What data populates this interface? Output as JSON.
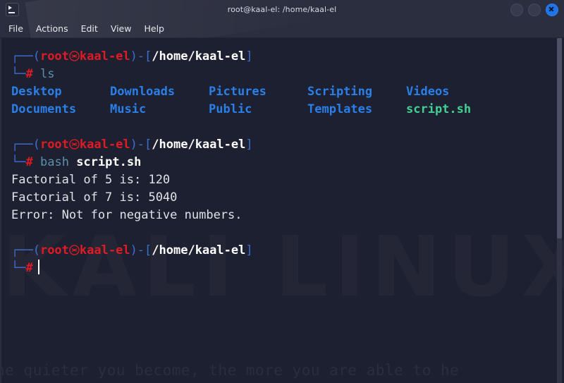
{
  "window": {
    "title": "root@kaal-el: /home/kaal-el",
    "icon": "terminal-icon",
    "buttons": {
      "minimize": "minimize",
      "maximize": "maximize",
      "close": "close"
    }
  },
  "menubar": {
    "items": [
      {
        "label": "File"
      },
      {
        "label": "Actions"
      },
      {
        "label": "Edit"
      },
      {
        "label": "View"
      },
      {
        "label": "Help"
      }
    ]
  },
  "watermark": {
    "logo": "KALI LINUX",
    "tagline": "he quieter you become, the more you are able to he"
  },
  "terminal": {
    "prompt": {
      "top_left": "┌──(",
      "user": "root",
      "separator": "㉿",
      "host": "kaal-el",
      "close_paren": ")-[",
      "path": "/home/kaal-el",
      "close_bracket": "]",
      "bottom_left": "└─",
      "hash": "#"
    },
    "blocks": [
      {
        "type": "command",
        "command": "ls",
        "args": ""
      },
      {
        "type": "ls-output",
        "row1": [
          {
            "name": "Desktop",
            "kind": "dir"
          },
          {
            "name": "Downloads",
            "kind": "dir"
          },
          {
            "name": "Pictures",
            "kind": "dir"
          },
          {
            "name": "Scripting",
            "kind": "dir"
          },
          {
            "name": "Videos",
            "kind": "dir"
          }
        ],
        "row2": [
          {
            "name": "Documents",
            "kind": "dir"
          },
          {
            "name": "Music",
            "kind": "dir"
          },
          {
            "name": "Public",
            "kind": "dir"
          },
          {
            "name": "Templates",
            "kind": "dir"
          },
          {
            "name": "script.sh",
            "kind": "exec"
          }
        ]
      },
      {
        "type": "command",
        "command": "bash",
        "args": "script.sh"
      },
      {
        "type": "output",
        "lines": [
          "Factorial of 5 is: 120",
          "Factorial of 7 is: 5040",
          "Error: Not for negative numbers."
        ]
      },
      {
        "type": "prompt-cursor"
      }
    ],
    "output": {
      "line1": "Factorial of 5 is: 120",
      "line2": "Factorial of 7 is: 5040",
      "line3": "Error: Not for negative numbers."
    },
    "commands": {
      "first": "ls",
      "second_cmd": "bash",
      "second_arg": "script.sh"
    },
    "files": {
      "r1c1": "Desktop",
      "r1c2": "Downloads",
      "r1c3": "Pictures",
      "r1c4": "Scripting",
      "r1c5": "Videos",
      "r2c1": "Documents",
      "r2c2": "Music",
      "r2c3": "Public",
      "r2c4": "Templates",
      "r2c5": "script.sh"
    }
  },
  "colors": {
    "background": "#1d2030",
    "titlebar": "#2b2e3e",
    "prompt_frame": "#3d6fd1",
    "prompt_user": "#e01b24",
    "path": "#ffffff",
    "command": "#5d8fa8",
    "directory": "#2a7fe8",
    "executable": "#44d093",
    "close_button": "#1f74e8"
  }
}
